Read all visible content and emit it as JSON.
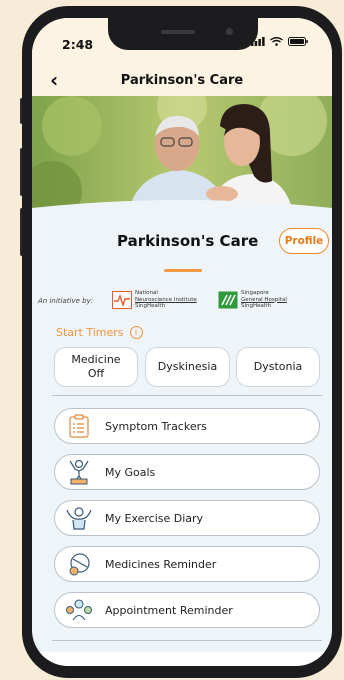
{
  "status_bar": {
    "time": "2:48"
  },
  "nav": {
    "title": "Parkinson's Care"
  },
  "header": {
    "title": "Parkinson's Care",
    "profile_label": "Profile"
  },
  "initiative": {
    "label": "An initiative by:",
    "org1": {
      "line1": "National",
      "line2": "Neuroscience Institute",
      "sub": "SingHealth"
    },
    "org2": {
      "line1": "Singapore",
      "line2": "General Hospital",
      "sub": "SingHealth"
    }
  },
  "timers": {
    "label": "Start Timers",
    "items": [
      "Medicine Off",
      "Dyskinesia",
      "Dystonia"
    ]
  },
  "menu": [
    {
      "label": "Symptom Trackers",
      "icon": "clipboard-icon"
    },
    {
      "label": "My Goals",
      "icon": "goal-trophy-icon"
    },
    {
      "label": "My Exercise Diary",
      "icon": "exercise-person-icon"
    },
    {
      "label": "Medicines Reminder",
      "icon": "pills-icon"
    },
    {
      "label": "Appointment Reminder",
      "icon": "appointment-icon"
    }
  ],
  "colors": {
    "accent": "#f0943a",
    "background": "#eef4f8",
    "header_bg": "#fdf3e2"
  }
}
